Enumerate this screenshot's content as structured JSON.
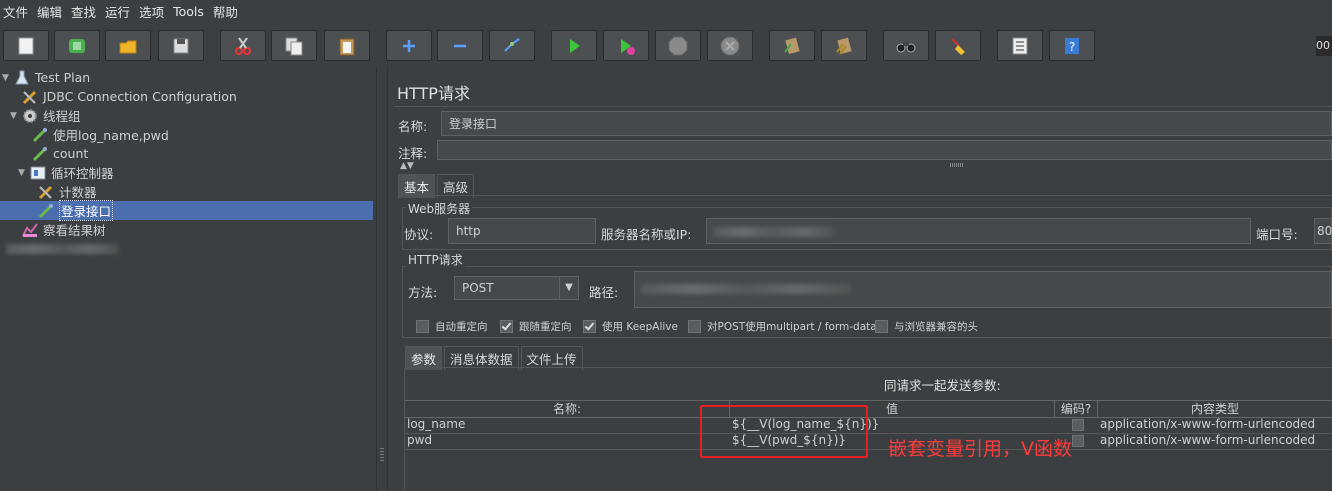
{
  "menu": [
    "文件",
    "编辑",
    "查找",
    "运行",
    "选项",
    "Tools",
    "帮助"
  ],
  "toolbar": {
    "buttons": [
      "new-icon",
      "templates-icon",
      "open-icon",
      "save-icon",
      "cut-icon",
      "copy-icon",
      "paste-icon",
      "add-icon",
      "remove-icon",
      "toggle-icon",
      "start-icon",
      "start-no-pause-icon",
      "stop-icon",
      "shutdown-icon",
      "clear-icon",
      "clear-all-icon",
      "search-icon",
      "reset-search-icon",
      "function-helper-icon",
      "help-icon"
    ],
    "clock": "00"
  },
  "tree": [
    {
      "label": "Test Plan",
      "icon": "flask-icon"
    },
    {
      "label": "JDBC Connection Configuration",
      "icon": "config-element-icon"
    },
    {
      "label": "线程组",
      "icon": "gear-icon"
    },
    {
      "label": "使用log_name,pwd",
      "icon": "sampler-icon"
    },
    {
      "label": "count",
      "icon": "sampler-icon"
    },
    {
      "label": "循环控制器",
      "icon": "controller-icon"
    },
    {
      "label": "计数器",
      "icon": "config-element-icon"
    },
    {
      "label": "登录接口",
      "icon": "sampler-icon"
    },
    {
      "label": "察看结果树",
      "icon": "listener-icon"
    }
  ],
  "panel": {
    "title": "HTTP请求",
    "name_label": "名称:",
    "name_value": "登录接口",
    "comment_label": "注释:",
    "tabs": [
      "基本",
      "高级"
    ],
    "web_server": {
      "title": "Web服务器",
      "protocol_label": "协议:",
      "protocol_value": "http",
      "server_label": "服务器名称或IP:",
      "port_label": "端口号:",
      "port_value": "80"
    },
    "http_request": {
      "title": "HTTP请求",
      "method_label": "方法:",
      "method_value": "POST",
      "path_label": "路径:"
    },
    "checkboxes": [
      {
        "label": "自动重定向",
        "checked": false
      },
      {
        "label": "跟随重定向",
        "checked": true
      },
      {
        "label": "使用 KeepAlive",
        "checked": true
      },
      {
        "label": "对POST使用multipart / form-data",
        "checked": false
      },
      {
        "label": "与浏览器兼容的头",
        "checked": false
      }
    ],
    "sub_tabs": [
      "参数",
      "消息体数据",
      "文件上传"
    ],
    "params_caption": "同请求一起发送参数:",
    "columns": [
      "名称:",
      "值",
      "编码?",
      "内容类型"
    ],
    "rows": [
      {
        "name": "log_name",
        "value": "${__V(log_name_${n})}",
        "encode": false,
        "content_type": "application/x-www-form-urlencoded"
      },
      {
        "name": "pwd",
        "value": "${__V(pwd_${n})}",
        "encode": false,
        "content_type": "application/x-www-form-urlencoded"
      }
    ],
    "annotation": "嵌套变量引用，V函数"
  }
}
